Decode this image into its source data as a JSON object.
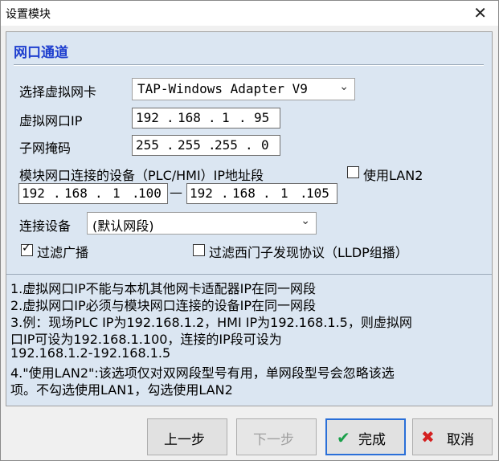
{
  "window": {
    "title": "设置模块",
    "close_glyph": "✕"
  },
  "section": {
    "title": "网口通道"
  },
  "adapter": {
    "label": "选择虚拟网卡",
    "value": "TAP-Windows Adapter V9"
  },
  "virtual_ip": {
    "label": "虚拟网口IP",
    "octets": [
      "192",
      "168",
      "1",
      "95"
    ]
  },
  "subnet_mask": {
    "label": "子网掩码",
    "octets": [
      "255",
      "255",
      "255",
      "0"
    ]
  },
  "device_ip": {
    "label": "模块网口连接的设备（PLC/HMI）IP地址段",
    "use_lan2": {
      "label": "使用LAN2",
      "checked": false
    },
    "start_octets": [
      "192",
      "168",
      "1",
      "100"
    ],
    "end_octets": [
      "192",
      "168",
      "1",
      "105"
    ],
    "range_separator": "—"
  },
  "connect_device": {
    "label": "连接设备",
    "value": "(默认网段)"
  },
  "filter_broadcast": {
    "label": "过滤广播",
    "checked": true
  },
  "filter_lldp": {
    "label": "过滤西门子发现协议（LLDP组播）",
    "checked": false
  },
  "notes": [
    "1.虚拟网口IP不能与本机其他网卡适配器IP在同一网段",
    "2.虚拟网口IP必须与模块网口连接的设备IP在同一网段",
    "3.例：现场PLC IP为192.168.1.2，HMI IP为192.168.1.5，则虚拟网",
    "口IP可设为192.168.1.100，连接的IP段可设为",
    "192.168.1.2-192.168.1.5",
    "4.\"使用LAN2\":该选项仅对双网段型号有用，单网段型号会忽略该选",
    "项。不勾选使用LAN1，勾选使用LAN2"
  ],
  "buttons": {
    "prev": "上一步",
    "next": "下一步",
    "finish": "完成",
    "cancel": "取消"
  },
  "icons": {
    "dropdown": "⌄",
    "finish": "✔",
    "cancel": "✖"
  },
  "colors": {
    "panel_bg": "#dbe6f2",
    "section_title": "#1f3fcf",
    "finish_border": "#2a6fd8",
    "finish_icon": "#1aa04a",
    "cancel_icon": "#d42020"
  }
}
